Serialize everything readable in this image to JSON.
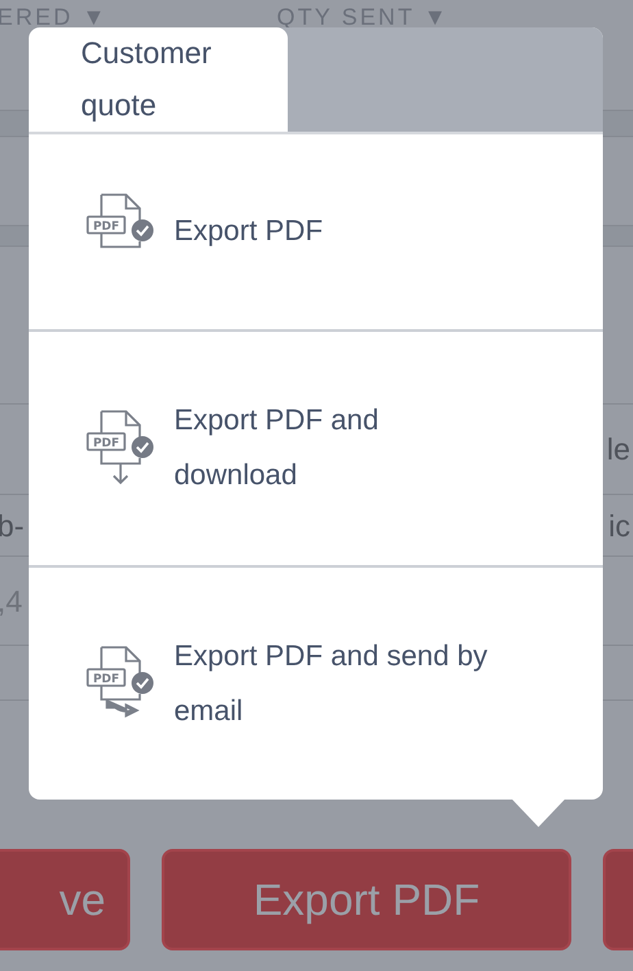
{
  "columns": [
    "ERED ▼",
    "QTY SENT ▼"
  ],
  "cell_fragments": [
    "le",
    "b-",
    "ic",
    ",4"
  ],
  "popover": {
    "tabs": [
      {
        "label": "Customer quote",
        "selected": true
      }
    ],
    "options": [
      {
        "kind": "export",
        "badge": "PDF",
        "label": "Export PDF"
      },
      {
        "kind": "download",
        "badge": "PDF",
        "label": "Export PDF and download"
      },
      {
        "kind": "email",
        "badge": "PDF",
        "label": "Export PDF and send by email"
      }
    ]
  },
  "buttons": [
    "ve",
    "Export PDF"
  ]
}
